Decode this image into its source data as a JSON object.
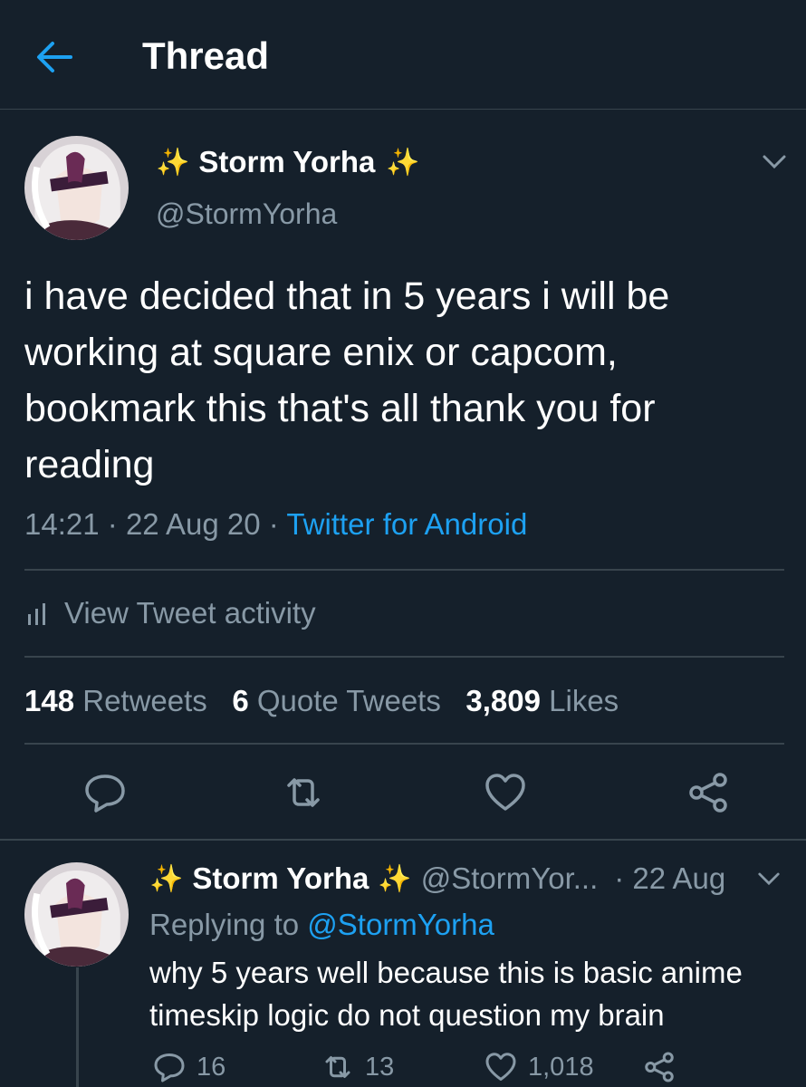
{
  "header": {
    "title": "Thread"
  },
  "tweet": {
    "name": "Storm Yorha",
    "sparkle": "✨",
    "handle": "@StormYorha",
    "text": "i have decided that in 5 years i will be working at square enix or capcom, bookmark this that's all thank you for reading",
    "time": "14:21",
    "date": "22 Aug 20",
    "sep": "·",
    "source": "Twitter for Android",
    "activity_label": "View Tweet activity",
    "retweets_count": "148",
    "retweets_label": "Retweets",
    "quotes_count": "6",
    "quotes_label": "Quote Tweets",
    "likes_count": "3,809",
    "likes_label": "Likes"
  },
  "reply": {
    "name": "Storm Yorha",
    "sparkle": "✨",
    "handle": "@StormYor...",
    "date": "· 22 Aug",
    "replying_prefix": "Replying to",
    "replying_to": "@StormYorha",
    "text": "why 5 years well because this is basic anime timeskip logic do not question my brain",
    "replies": "16",
    "retweets": "13",
    "likes": "1,018"
  },
  "icons": {
    "back": "arrow-left",
    "chevron": "chevron-down",
    "activity": "bar-chart",
    "reply": "speech-bubble",
    "retweet": "retweet-arrows",
    "like": "heart",
    "share": "share-nodes"
  },
  "colors": {
    "background": "#15202b",
    "accent": "#1da1f2",
    "muted": "#8899a6",
    "divider": "#38444d"
  }
}
